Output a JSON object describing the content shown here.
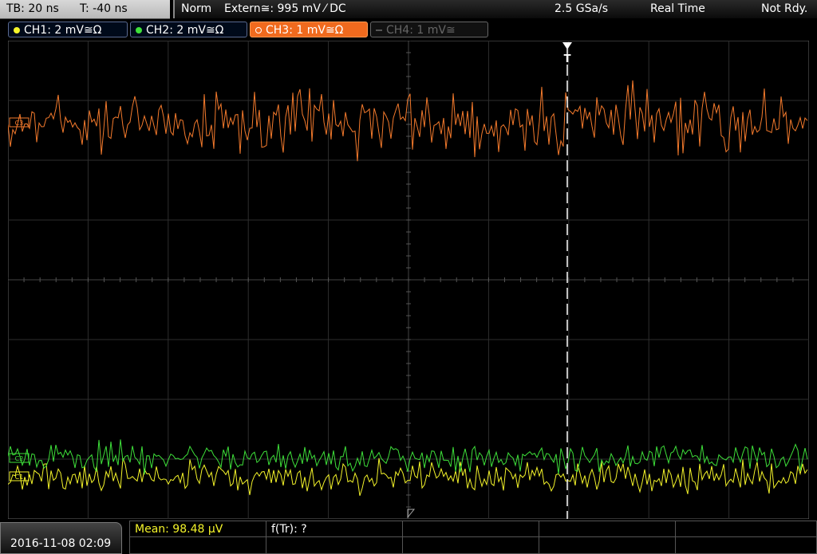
{
  "timebase": {
    "tb": "TB: 20 ns",
    "t": "T: -40 ns"
  },
  "status": {
    "mode": "Norm",
    "trigger": "Extern≅: 995 mV ⁄ DC",
    "sample_rate": "2.5 GSa/s",
    "acq": "Real Time",
    "state": "Not Rdy."
  },
  "channels": [
    {
      "label": "CH1: 2 mV≅Ω",
      "color": "#f4f42a"
    },
    {
      "label": "CH2: 2 mV≅Ω",
      "color": "#3ee03a"
    },
    {
      "label": "CH3: 1 mV≅Ω",
      "color": "#f47a2c"
    },
    {
      "label": "CH4: 1 mV≅",
      "color": "#666666"
    }
  ],
  "markers": {
    "ch3": "C3",
    "ch2": "C2",
    "ch1": "C1",
    "trigger": "T"
  },
  "date": "2016-11-08 02:09",
  "measurements": {
    "mean": "Mean: 98.48 µV",
    "freq": "f(Tr): ?"
  }
}
